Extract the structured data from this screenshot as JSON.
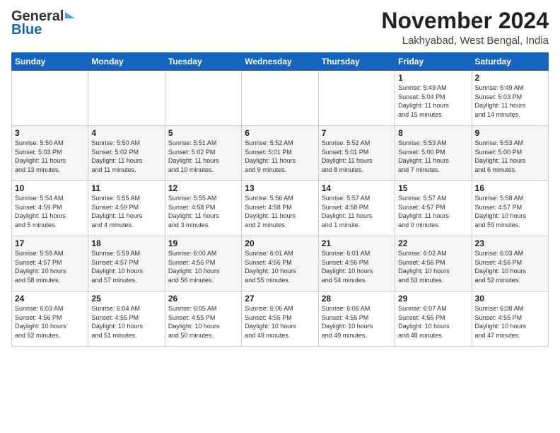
{
  "logo": {
    "general": "General",
    "blue": "Blue"
  },
  "header": {
    "month": "November 2024",
    "location": "Lakhyabad, West Bengal, India"
  },
  "days_of_week": [
    "Sunday",
    "Monday",
    "Tuesday",
    "Wednesday",
    "Thursday",
    "Friday",
    "Saturday"
  ],
  "weeks": [
    [
      {
        "day": "",
        "info": ""
      },
      {
        "day": "",
        "info": ""
      },
      {
        "day": "",
        "info": ""
      },
      {
        "day": "",
        "info": ""
      },
      {
        "day": "",
        "info": ""
      },
      {
        "day": "1",
        "info": "Sunrise: 5:49 AM\nSunset: 5:04 PM\nDaylight: 11 hours\nand 15 minutes."
      },
      {
        "day": "2",
        "info": "Sunrise: 5:49 AM\nSunset: 5:03 PM\nDaylight: 11 hours\nand 14 minutes."
      }
    ],
    [
      {
        "day": "3",
        "info": "Sunrise: 5:50 AM\nSunset: 5:03 PM\nDaylight: 11 hours\nand 13 minutes."
      },
      {
        "day": "4",
        "info": "Sunrise: 5:50 AM\nSunset: 5:02 PM\nDaylight: 11 hours\nand 11 minutes."
      },
      {
        "day": "5",
        "info": "Sunrise: 5:51 AM\nSunset: 5:02 PM\nDaylight: 11 hours\nand 10 minutes."
      },
      {
        "day": "6",
        "info": "Sunrise: 5:52 AM\nSunset: 5:01 PM\nDaylight: 11 hours\nand 9 minutes."
      },
      {
        "day": "7",
        "info": "Sunrise: 5:52 AM\nSunset: 5:01 PM\nDaylight: 11 hours\nand 8 minutes."
      },
      {
        "day": "8",
        "info": "Sunrise: 5:53 AM\nSunset: 5:00 PM\nDaylight: 11 hours\nand 7 minutes."
      },
      {
        "day": "9",
        "info": "Sunrise: 5:53 AM\nSunset: 5:00 PM\nDaylight: 11 hours\nand 6 minutes."
      }
    ],
    [
      {
        "day": "10",
        "info": "Sunrise: 5:54 AM\nSunset: 4:59 PM\nDaylight: 11 hours\nand 5 minutes."
      },
      {
        "day": "11",
        "info": "Sunrise: 5:55 AM\nSunset: 4:59 PM\nDaylight: 11 hours\nand 4 minutes."
      },
      {
        "day": "12",
        "info": "Sunrise: 5:55 AM\nSunset: 4:58 PM\nDaylight: 11 hours\nand 3 minutes."
      },
      {
        "day": "13",
        "info": "Sunrise: 5:56 AM\nSunset: 4:58 PM\nDaylight: 11 hours\nand 2 minutes."
      },
      {
        "day": "14",
        "info": "Sunrise: 5:57 AM\nSunset: 4:58 PM\nDaylight: 11 hours\nand 1 minute."
      },
      {
        "day": "15",
        "info": "Sunrise: 5:57 AM\nSunset: 4:57 PM\nDaylight: 11 hours\nand 0 minutes."
      },
      {
        "day": "16",
        "info": "Sunrise: 5:58 AM\nSunset: 4:57 PM\nDaylight: 10 hours\nand 59 minutes."
      }
    ],
    [
      {
        "day": "17",
        "info": "Sunrise: 5:59 AM\nSunset: 4:57 PM\nDaylight: 10 hours\nand 58 minutes."
      },
      {
        "day": "18",
        "info": "Sunrise: 5:59 AM\nSunset: 4:57 PM\nDaylight: 10 hours\nand 57 minutes."
      },
      {
        "day": "19",
        "info": "Sunrise: 6:00 AM\nSunset: 4:56 PM\nDaylight: 10 hours\nand 56 minutes."
      },
      {
        "day": "20",
        "info": "Sunrise: 6:01 AM\nSunset: 4:56 PM\nDaylight: 10 hours\nand 55 minutes."
      },
      {
        "day": "21",
        "info": "Sunrise: 6:01 AM\nSunset: 4:56 PM\nDaylight: 10 hours\nand 54 minutes."
      },
      {
        "day": "22",
        "info": "Sunrise: 6:02 AM\nSunset: 4:56 PM\nDaylight: 10 hours\nand 53 minutes."
      },
      {
        "day": "23",
        "info": "Sunrise: 6:03 AM\nSunset: 4:56 PM\nDaylight: 10 hours\nand 52 minutes."
      }
    ],
    [
      {
        "day": "24",
        "info": "Sunrise: 6:03 AM\nSunset: 4:56 PM\nDaylight: 10 hours\nand 52 minutes."
      },
      {
        "day": "25",
        "info": "Sunrise: 6:04 AM\nSunset: 4:55 PM\nDaylight: 10 hours\nand 51 minutes."
      },
      {
        "day": "26",
        "info": "Sunrise: 6:05 AM\nSunset: 4:55 PM\nDaylight: 10 hours\nand 50 minutes."
      },
      {
        "day": "27",
        "info": "Sunrise: 6:06 AM\nSunset: 4:55 PM\nDaylight: 10 hours\nand 49 minutes."
      },
      {
        "day": "28",
        "info": "Sunrise: 6:06 AM\nSunset: 4:55 PM\nDaylight: 10 hours\nand 49 minutes."
      },
      {
        "day": "29",
        "info": "Sunrise: 6:07 AM\nSunset: 4:55 PM\nDaylight: 10 hours\nand 48 minutes."
      },
      {
        "day": "30",
        "info": "Sunrise: 6:08 AM\nSunset: 4:55 PM\nDaylight: 10 hours\nand 47 minutes."
      }
    ]
  ]
}
